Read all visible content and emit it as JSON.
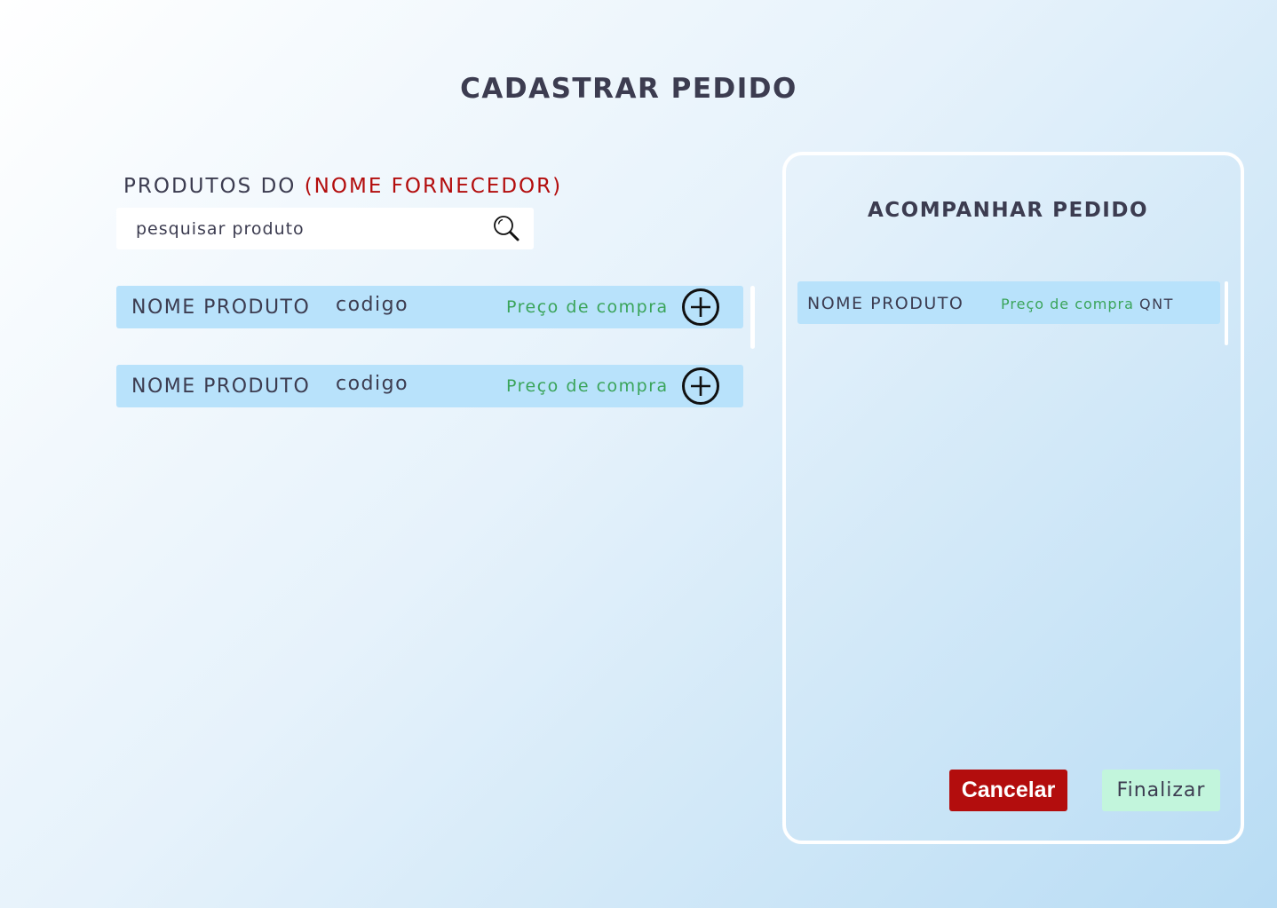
{
  "page": {
    "title": "CADASTRAR PEDIDO"
  },
  "products_section": {
    "heading_prefix": "PRODUTOS DO",
    "supplier_name": "(NOME FORNECEDOR)",
    "search": {
      "placeholder": "pesquisar produto",
      "value": "",
      "icon": "search-icon"
    },
    "items": [
      {
        "name": "NOME PRODUTO",
        "code": "codigo",
        "price": "Preço de compra",
        "action_icon": "plus-circle-icon"
      },
      {
        "name": "NOME PRODUTO",
        "code": "codigo",
        "price": "Preço de compra",
        "action_icon": "plus-circle-icon"
      }
    ]
  },
  "order_panel": {
    "title": "ACOMPANHAR PEDIDO",
    "items": [
      {
        "name": "NOME PRODUTO",
        "price": "Preço de compra",
        "qty": "QNT"
      }
    ],
    "cancel_label": "Cancelar",
    "finalize_label": "Finalizar"
  },
  "colors": {
    "title_text": "#3c3c50",
    "supplier_name": "#b30d0d",
    "price_text": "#3aa45a",
    "row_background": "#b8e2fb",
    "cancel_button": "#b30d0d",
    "finalize_button": "#c2f5dc"
  }
}
